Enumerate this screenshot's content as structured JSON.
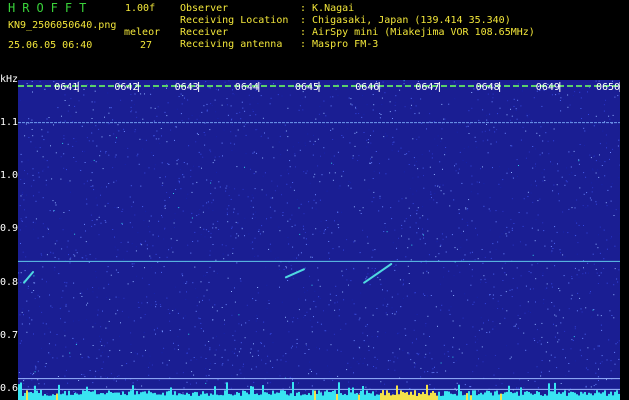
{
  "header": {
    "app_title": "HROFFT",
    "app_version": "1.00f",
    "file_name": "KN9_2506050640.png",
    "timestamp": "25.06.05 06:40",
    "meleor_label": "meleor",
    "meleor_count": "27",
    "info": [
      {
        "key": "Observer",
        "value": ": K.Nagai"
      },
      {
        "key": "Receiving Location",
        "value": ": Chigasaki, Japan (139.414 35.340)"
      },
      {
        "key": "Receiver",
        "value": ": AirSpy mini (Miakejima VOR 108.65MHz)"
      },
      {
        "key": "Receiving antenna",
        "value": ": Maspro FM-3"
      }
    ]
  },
  "colors": {
    "background": "#000000",
    "spectrogram": "#1a1e93",
    "header_green": "#39d23a",
    "header_yellow": "#f2e63a",
    "trace_cyan": "#4fd8e0"
  },
  "chart_data": {
    "type": "heatmap",
    "ylabel": "kHz",
    "y_ticks": [
      "1.1",
      "1.0",
      "0.9",
      "0.8",
      "0.7",
      "0.6"
    ],
    "time_ticks": [
      "0641",
      "0642",
      "0643",
      "0644",
      "0645",
      "0646",
      "0647",
      "0648",
      "0649",
      "0650"
    ],
    "xlim": [
      "06:40",
      "06:50"
    ],
    "ylim": [
      0.58,
      1.18
    ],
    "persistent_lines_khz": [
      1.1,
      0.84,
      0.62,
      0.6
    ],
    "echoes": [
      {
        "start_min": 4.45,
        "end_min": 4.75,
        "khz_start": 0.81,
        "khz_end": 0.825
      },
      {
        "start_min": 5.75,
        "end_min": 6.2,
        "khz_start": 0.8,
        "khz_end": 0.835
      },
      {
        "start_min": 0.1,
        "end_min": 0.25,
        "khz_start": 0.8,
        "khz_end": 0.82
      }
    ]
  }
}
